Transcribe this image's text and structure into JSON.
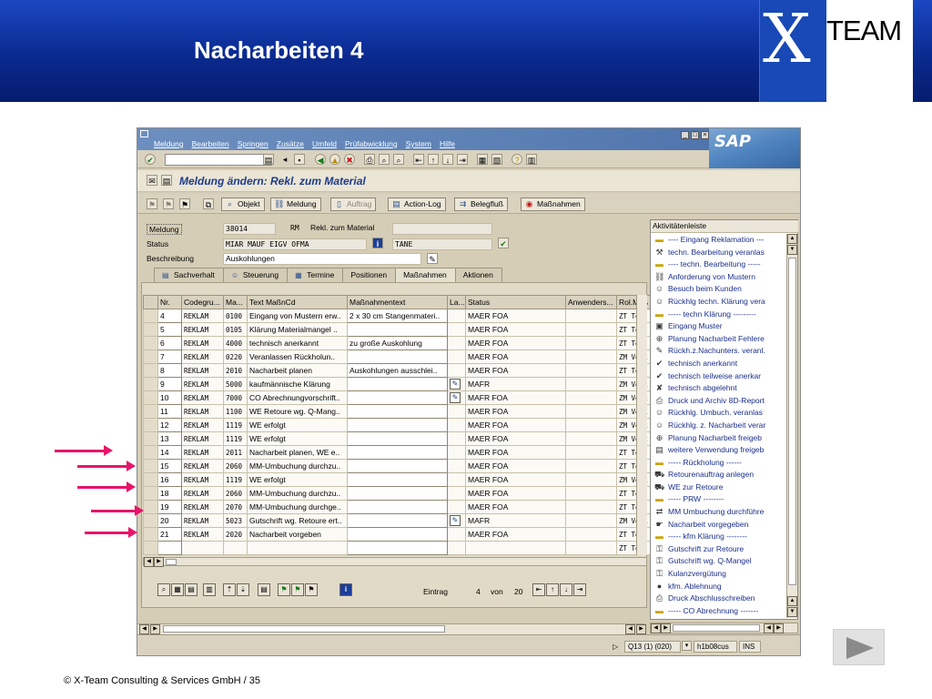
{
  "slide": {
    "title": "Nacharbeiten 4",
    "logo_x": "X",
    "logo_team": "TEAM",
    "footer": "©  X-Team Consulting & Services GmbH  / 35"
  },
  "sap": {
    "menu": [
      "Meldung",
      "Bearbeiten",
      "Springen",
      "Zusätze",
      "Umfeld",
      "Prüfabwicklung",
      "System",
      "Hilfe"
    ],
    "logo": "SAP",
    "screen_title": "Meldung ändern: Rekl. zum Material",
    "app_buttons": {
      "objekt": "Objekt",
      "meldung": "Meldung",
      "auftrag": "Auftrag",
      "action_log": "Action-Log",
      "belegfluss": "Belegfluß",
      "massnahmen": "Maßnahmen"
    },
    "header": {
      "meldung_label": "Meldung",
      "meldung_no": "38014",
      "meldung_art": "RM",
      "meldung_text": "Rekl. zum Material",
      "status_label": "Status",
      "status_value": "MIAR MAUF EIGV OFMA",
      "status_user": "TANE",
      "beschreibung_label": "Beschreibung",
      "beschreibung_value": "Auskohlungen"
    },
    "tabs": [
      "Sachverhalt",
      "Steuerung",
      "Termine",
      "Positionen",
      "Maßnahmen",
      "Aktionen"
    ],
    "table": {
      "columns": [
        "Nr.",
        "Codegru...",
        "Ma...",
        "Text MaßnCd",
        "Maßnahmentext",
        "La...",
        "Status",
        "Anwenders...",
        "Rol.Maß"
      ],
      "rows": [
        {
          "nr": "4",
          "code": "REKLAM",
          "ma": "0100",
          "text": "Eingang von Mustern erw..",
          "mtext": "2 x 30 cm Stangenmateri..",
          "la": "",
          "status": "MAER FOA",
          "anw": "",
          "rol": "ZT Tech"
        },
        {
          "nr": "5",
          "code": "REKLAM",
          "ma": "0105",
          "text": "Klärung Materialmangel ..",
          "mtext": "",
          "la": "",
          "status": "MAER FOA",
          "anw": "",
          "rol": "ZT Tech"
        },
        {
          "nr": "6",
          "code": "REKLAM",
          "ma": "4000",
          "text": "technisch anerkannt",
          "mtext": "zu große Auskohlung",
          "la": "",
          "status": "MAER FOA",
          "anw": "",
          "rol": "ZT Tech"
        },
        {
          "nr": "7",
          "code": "REKLAM",
          "ma": "0220",
          "text": "Veranlassen Rückholun..",
          "mtext": "",
          "la": "",
          "status": "MAER FOA",
          "anw": "",
          "rol": "ZM Verk"
        },
        {
          "nr": "8",
          "code": "REKLAM",
          "ma": "2010",
          "text": "Nacharbeit planen",
          "mtext": "Auskohlungen ausschlei..",
          "la": "",
          "status": "MAER FOA",
          "anw": "",
          "rol": "ZT Tech"
        },
        {
          "nr": "9",
          "code": "REKLAM",
          "ma": "5000",
          "text": "kaufmännische Klärung",
          "mtext": "",
          "la": "edit",
          "status": "MAFR",
          "anw": "",
          "rol": "ZM Verk"
        },
        {
          "nr": "10",
          "code": "REKLAM",
          "ma": "7000",
          "text": "CO Abrechnungvorschrift..",
          "mtext": "",
          "la": "edit",
          "status": "MAFR FOA",
          "anw": "",
          "rol": "ZM Verk"
        },
        {
          "nr": "11",
          "code": "REKLAM",
          "ma": "1100",
          "text": "WE Retoure wg. Q-Mang..",
          "mtext": "",
          "la": "",
          "status": "MAER FOA",
          "anw": "",
          "rol": "ZM Verk"
        },
        {
          "nr": "12",
          "code": "REKLAM",
          "ma": "1119",
          "text": "WE erfolgt",
          "mtext": "",
          "la": "",
          "status": "MAER FOA",
          "anw": "",
          "rol": "ZM Verk"
        },
        {
          "nr": "13",
          "code": "REKLAM",
          "ma": "1119",
          "text": "WE erfolgt",
          "mtext": "",
          "la": "",
          "status": "MAER FOA",
          "anw": "",
          "rol": "ZM Verk"
        },
        {
          "nr": "14",
          "code": "REKLAM",
          "ma": "2011",
          "text": "Nacharbeit planen, WE e..",
          "mtext": "",
          "la": "",
          "status": "MAER FOA",
          "anw": "",
          "rol": "ZT Tech"
        },
        {
          "nr": "15",
          "code": "REKLAM",
          "ma": "2060",
          "text": "MM-Umbuchung durchzu..",
          "mtext": "",
          "la": "",
          "status": "MAER FOA",
          "anw": "",
          "rol": "ZT Tech"
        },
        {
          "nr": "16",
          "code": "REKLAM",
          "ma": "1119",
          "text": "WE erfolgt",
          "mtext": "",
          "la": "",
          "status": "MAER FOA",
          "anw": "",
          "rol": "ZM Verk"
        },
        {
          "nr": "18",
          "code": "REKLAM",
          "ma": "2060",
          "text": "MM-Umbuchung durchzu..",
          "mtext": "",
          "la": "",
          "status": "MAER FOA",
          "anw": "",
          "rol": "ZT Tech"
        },
        {
          "nr": "19",
          "code": "REKLAM",
          "ma": "2070",
          "text": "MM-Umbuchung durchge..",
          "mtext": "",
          "la": "",
          "status": "MAER FOA",
          "anw": "",
          "rol": "ZT Tech"
        },
        {
          "nr": "20",
          "code": "REKLAM",
          "ma": "5023",
          "text": "Gutschrift wg. Retoure ert..",
          "mtext": "",
          "la": "edit",
          "status": "MAFR",
          "anw": "",
          "rol": "ZM Verk"
        },
        {
          "nr": "21",
          "code": "REKLAM",
          "ma": "2020",
          "text": "Nacharbeit vorgeben",
          "mtext": "",
          "la": "",
          "status": "MAER FOA",
          "anw": "",
          "rol": "ZT Tech"
        },
        {
          "nr": "",
          "code": "",
          "ma": "",
          "text": "",
          "mtext": "",
          "la": "",
          "status": "",
          "anw": "",
          "rol": "ZT Tech"
        }
      ]
    },
    "paging": {
      "eintrag_label": "Eintrag",
      "current": "4",
      "von_label": "von",
      "total": "20"
    },
    "side_panel": {
      "title": "Aktivitätenleiste",
      "items": [
        {
          "icon": "separator-icon",
          "glyph": "▬",
          "label": "---- Eingang Reklamation ---",
          "sep": true
        },
        {
          "icon": "wrench-icon",
          "glyph": "⚒",
          "label": "techn. Bearbeitung veranlas",
          "sep": false
        },
        {
          "icon": "separator-icon",
          "glyph": "▬",
          "label": "---- techn. Bearbeitung -----",
          "sep": true
        },
        {
          "icon": "workflow-icon",
          "glyph": "⛓",
          "label": "Anforderung von Mustern",
          "sep": false
        },
        {
          "icon": "people-icon",
          "glyph": "☺",
          "label": "Besuch beim Kunden",
          "sep": false
        },
        {
          "icon": "people-icon",
          "glyph": "☺",
          "label": "Rückhlg techn. Klärung vera",
          "sep": false
        },
        {
          "icon": "separator-icon",
          "glyph": "▬",
          "label": "----- techn Klärung ---------",
          "sep": true
        },
        {
          "icon": "box-icon",
          "glyph": "▣",
          "label": "Eingang Muster",
          "sep": false
        },
        {
          "icon": "plan-icon",
          "glyph": "⊕",
          "label": "Planung Nacharbeit Fehlere",
          "sep": false
        },
        {
          "icon": "edit-doc-icon",
          "glyph": "✎",
          "label": "Rückh.z.Nachunters. veranl.",
          "sep": false
        },
        {
          "icon": "check-icon",
          "glyph": "✔",
          "label": "technisch anerkannt",
          "sep": false
        },
        {
          "icon": "check-icon",
          "glyph": "✔",
          "label": "technisch teilweise anerkar",
          "sep": false
        },
        {
          "icon": "reject-icon",
          "glyph": "✘",
          "label": "technisch abgelehnt",
          "sep": false
        },
        {
          "icon": "printer-icon",
          "glyph": "⎙",
          "label": "Druck und Archiv 8D-Report",
          "sep": false
        },
        {
          "icon": "people-icon",
          "glyph": "☺",
          "label": "Rückhlg. Umbuch. veranlas",
          "sep": false
        },
        {
          "icon": "people-icon",
          "glyph": "☺",
          "label": "Rückhlg. z. Nacharbeit verar",
          "sep": false
        },
        {
          "icon": "plan-icon",
          "glyph": "⊕",
          "label": "Planung Nacharbeit freigeb",
          "sep": false
        },
        {
          "icon": "document-icon",
          "glyph": "▤",
          "label": "weitere Verwendung freigeb",
          "sep": false
        },
        {
          "icon": "separator-icon",
          "glyph": "▬",
          "label": "----- Rückholung ------",
          "sep": true
        },
        {
          "icon": "truck-icon",
          "glyph": "⛟",
          "label": "Retourenauftrag anlegen",
          "sep": false
        },
        {
          "icon": "truck-icon",
          "glyph": "⛟",
          "label": "WE zur Retoure",
          "sep": false
        },
        {
          "icon": "separator-icon",
          "glyph": "▬",
          "label": "-----  PRW --------",
          "sep": true
        },
        {
          "icon": "transfer-icon",
          "glyph": "⇄",
          "label": "MM Umbuchung durchführe",
          "sep": false
        },
        {
          "icon": "hand-icon",
          "glyph": "☛",
          "label": "Nacharbeit vorgegeben",
          "sep": false
        },
        {
          "icon": "separator-icon",
          "glyph": "▬",
          "label": "-----  kfm Klärung --------",
          "sep": true
        },
        {
          "icon": "key-icon",
          "glyph": "⚿",
          "label": "Gutschrift zur Retoure",
          "sep": false
        },
        {
          "icon": "key-icon",
          "glyph": "⚿",
          "label": "Gutschrift wg. Q-Mangel",
          "sep": false
        },
        {
          "icon": "key-icon",
          "glyph": "⚿",
          "label": "Kulanzvergütung",
          "sep": false
        },
        {
          "icon": "reject-dot-icon",
          "glyph": "●",
          "label": "kfm. Ablehnung",
          "sep": false
        },
        {
          "icon": "printer-icon",
          "glyph": "⎙",
          "label": "Druck Abschlusschreiben",
          "sep": false
        },
        {
          "icon": "separator-icon",
          "glyph": "▬",
          "label": "-----  CO Abrechnung  -------",
          "sep": true
        }
      ]
    },
    "status_bar": {
      "system": "Q13 (1) (020)",
      "host": "h1b08cus",
      "mode": "INS"
    },
    "colors": {
      "accent_arrow": "#e8146a",
      "title_bar": "#1b47c2",
      "sap_bg": "#d6cdb6"
    }
  }
}
